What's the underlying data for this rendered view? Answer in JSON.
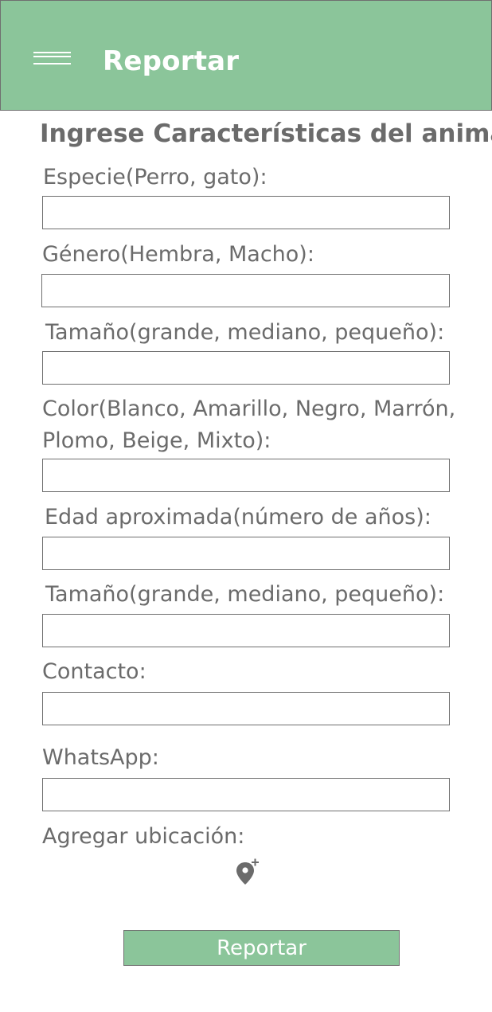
{
  "appbar": {
    "title": "Reportar",
    "menu_icon": "hamburger-menu-icon",
    "background_color": "#8bc59a"
  },
  "form": {
    "heading": "Ingrese Características del animal",
    "fields": {
      "especie": {
        "label": "Especie(Perro, gato):",
        "value": ""
      },
      "genero": {
        "label": "Género(Hembra, Macho):",
        "value": ""
      },
      "tamano_1": {
        "label": "Tamaño(grande, mediano, pequeño):",
        "value": ""
      },
      "color": {
        "label": "Color(Blanco, Amarillo, Negro, Marrón, Plomo, Beige, Mixto):",
        "value": ""
      },
      "edad": {
        "label": "Edad aproximada(número de años):",
        "value": ""
      },
      "tamano_2": {
        "label": "Tamaño(grande, mediano, pequeño):",
        "value": ""
      },
      "contacto": {
        "label": "Contacto:",
        "value": ""
      },
      "whatsapp": {
        "label": "WhatsApp:",
        "value": ""
      }
    },
    "location": {
      "label": "Agregar ubicación:",
      "icon": "add-location-pin-icon"
    },
    "submit_label": "Reportar"
  },
  "colors": {
    "accent": "#8bc59a",
    "text": "#6b6b6b",
    "border": "#6f6f6f"
  }
}
